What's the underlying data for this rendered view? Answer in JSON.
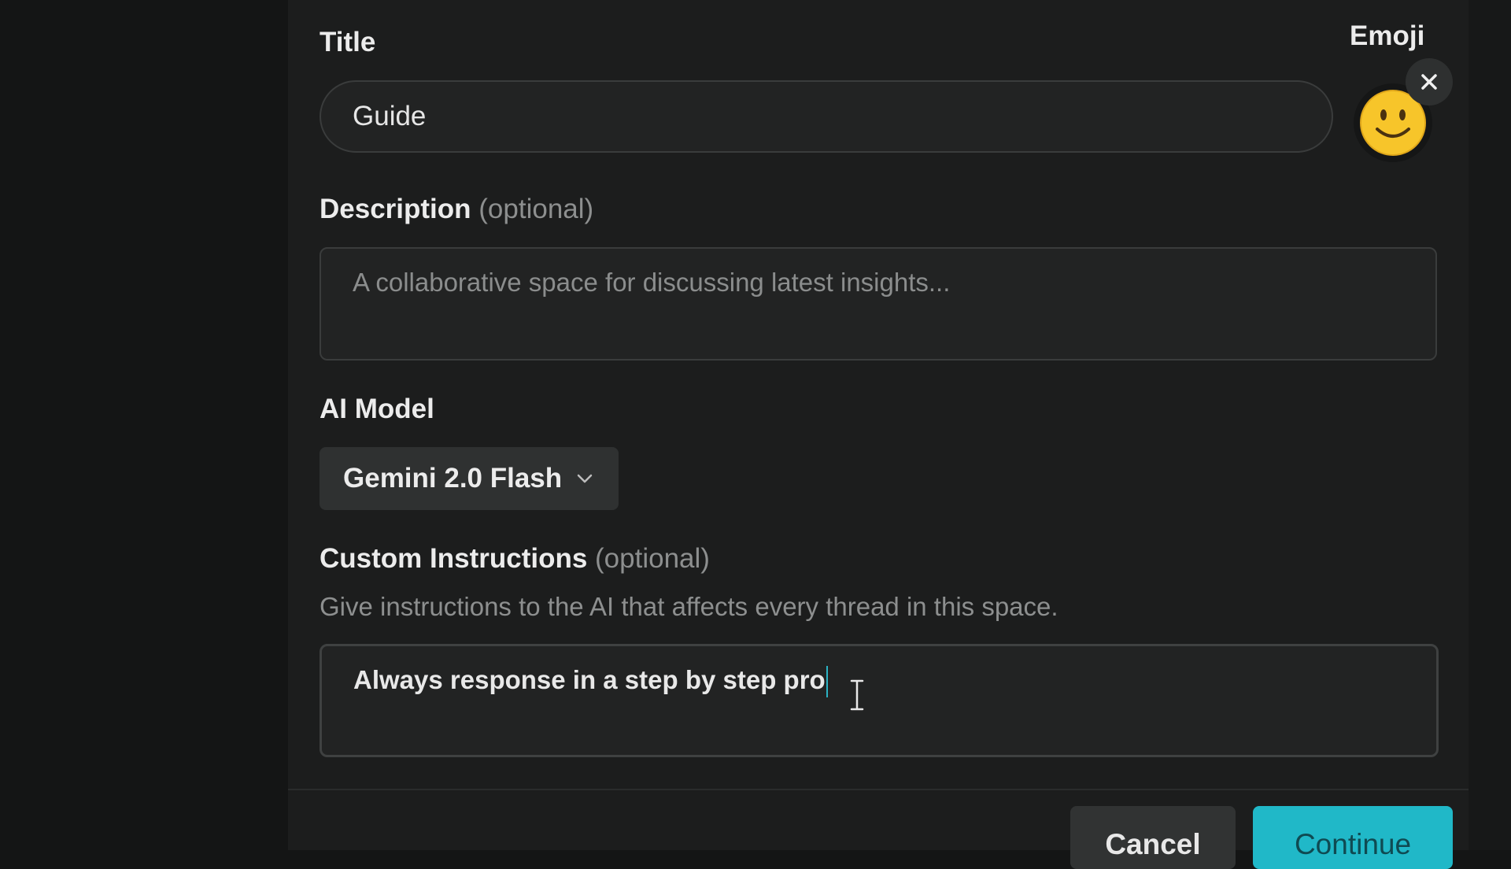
{
  "form": {
    "title_label": "Title",
    "title_value": "Guide",
    "emoji_label": "Emoji",
    "emoji_icon": "smiley-face-icon",
    "description_label": "Description",
    "description_optional": "(optional)",
    "description_placeholder": "A collaborative space for discussing latest insights...",
    "model_label": "AI Model",
    "model_selected": "Gemini 2.0 Flash",
    "instructions_label": "Custom Instructions",
    "instructions_optional": "(optional)",
    "instructions_help": "Give instructions to the AI that affects every thread in this space.",
    "instructions_value": "Always response in a step by step pro"
  },
  "footer": {
    "cancel_label": "Cancel",
    "continue_label": "Continue"
  },
  "colors": {
    "background": "#141515",
    "modal": "#1c1d1d",
    "accent": "#20b8c8"
  }
}
